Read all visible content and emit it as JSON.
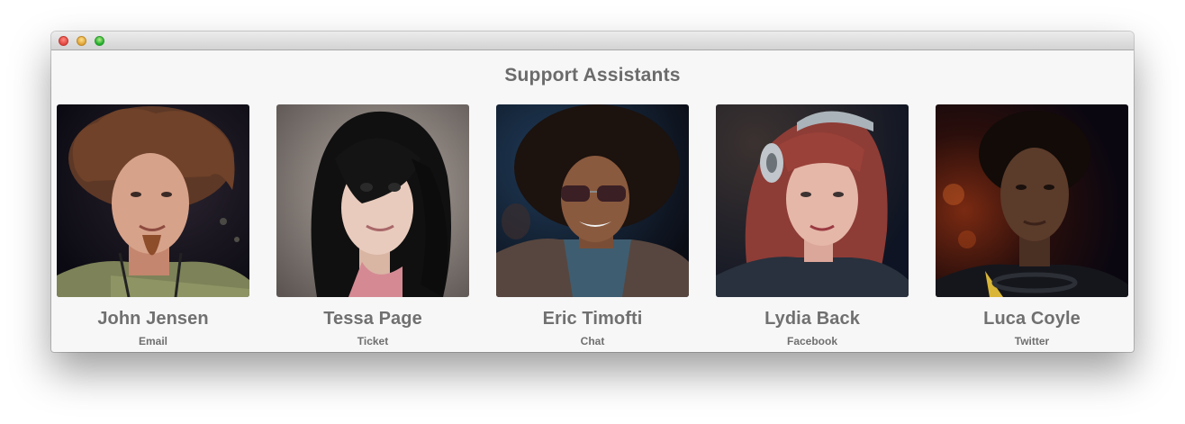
{
  "window": {
    "title": "",
    "controls": [
      "close",
      "minimize",
      "zoom"
    ]
  },
  "page": {
    "heading": "Support Assistants"
  },
  "assistants": [
    {
      "name": "John Jensen",
      "channel": "Email",
      "photo": "portrait-photo",
      "accent": "#7b4a2c"
    },
    {
      "name": "Tessa Page",
      "channel": "Ticket",
      "photo": "portrait-photo",
      "accent": "#151515"
    },
    {
      "name": "Eric Timofti",
      "channel": "Chat",
      "photo": "portrait-photo",
      "accent": "#2c1c14"
    },
    {
      "name": "Lydia Back",
      "channel": "Facebook",
      "photo": "portrait-photo",
      "accent": "#a8463e"
    },
    {
      "name": "Luca Coyle",
      "channel": "Twitter",
      "photo": "portrait-photo",
      "accent": "#1e1411"
    }
  ],
  "colors": {
    "window_bg": "#f7f7f7",
    "heading": "#6b6b6b",
    "text": "#707070"
  }
}
